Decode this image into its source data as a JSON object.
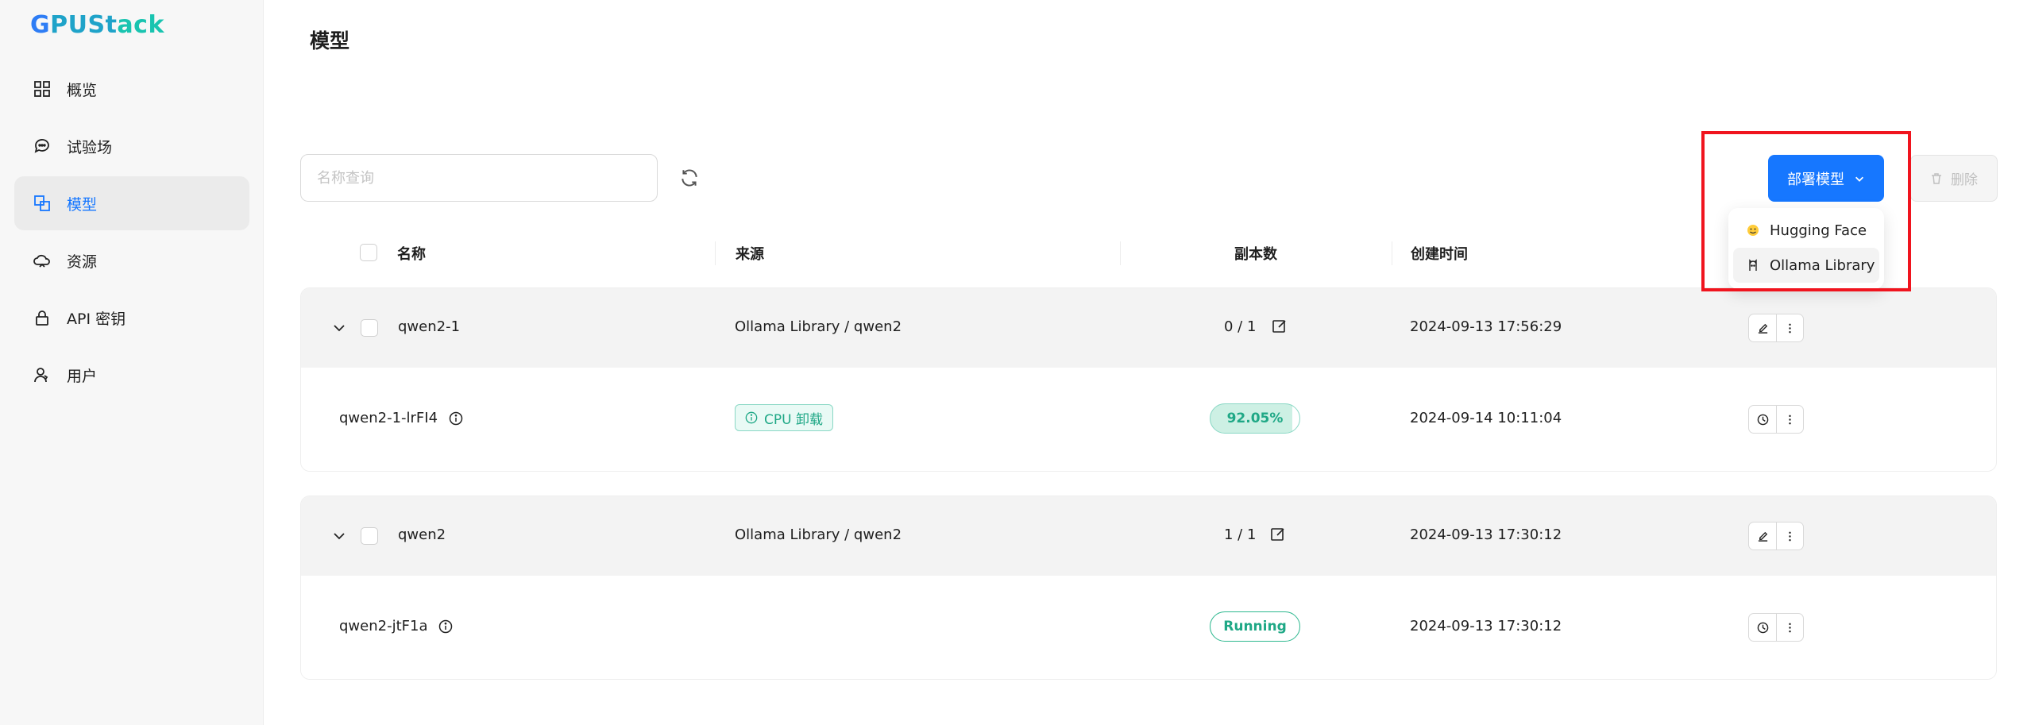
{
  "brand": {
    "logo_text": [
      "G",
      "PUSt",
      "ack"
    ]
  },
  "sidebar": {
    "items": [
      {
        "label": "概览",
        "icon": "dashboard-icon"
      },
      {
        "label": "试验场",
        "icon": "chat-icon"
      },
      {
        "label": "模型",
        "icon": "models-icon",
        "active": true
      },
      {
        "label": "资源",
        "icon": "cloud-icon"
      },
      {
        "label": "API 密钥",
        "icon": "lock-icon"
      },
      {
        "label": "用户",
        "icon": "users-icon"
      }
    ]
  },
  "page": {
    "title": "模型"
  },
  "toolbar": {
    "search_placeholder": "名称查询",
    "deploy_label": "部署模型",
    "delete_label": "删除"
  },
  "deploy_menu": {
    "items": [
      {
        "label": "Hugging Face",
        "icon": "hugging-face-icon"
      },
      {
        "label": "Ollama Library",
        "icon": "ollama-icon"
      }
    ]
  },
  "table": {
    "columns": [
      "名称",
      "来源",
      "副本数",
      "创建时间"
    ],
    "groups": [
      {
        "name": "qwen2-1",
        "source": "Ollama Library / qwen2",
        "replicas": "0 / 1",
        "created": "2024-09-13 17:56:29",
        "instance": {
          "name": "qwen2-1-lrFI4",
          "tag": "CPU 卸载",
          "progress_text": "92.05%",
          "progress": 0.9205,
          "created": "2024-09-14 10:11:04"
        }
      },
      {
        "name": "qwen2",
        "source": "Ollama Library / qwen2",
        "replicas": "1 / 1",
        "created": "2024-09-13 17:30:12",
        "instance": {
          "name": "qwen2-jtF1a",
          "status": "Running",
          "created": "2024-09-13 17:30:12"
        }
      }
    ]
  },
  "colors": {
    "primary": "#1677ff",
    "success": "#1fa886",
    "highlight": "#f0141e"
  }
}
